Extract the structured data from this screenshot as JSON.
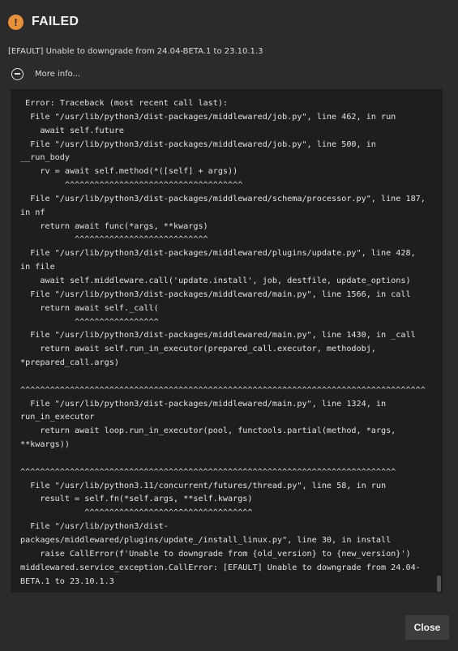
{
  "header": {
    "icon": "warning-icon",
    "icon_glyph": "!",
    "accent_color": "#e8913a",
    "title": "FAILED"
  },
  "message": "[EFAULT] Unable to downgrade from 24.04-BETA.1 to 23.10.1.3",
  "more_info": {
    "icon": "minus-circle-icon",
    "label": "More info..."
  },
  "traceback": [
    " Error: Traceback (most recent call last):",
    "  File \"/usr/lib/python3/dist-packages/middlewared/job.py\", line 462, in run",
    "    await self.future",
    "  File \"/usr/lib/python3/dist-packages/middlewared/job.py\", line 500, in",
    "__run_body",
    "    rv = await self.method(*([self] + args))",
    "         ^^^^^^^^^^^^^^^^^^^^^^^^^^^^^^^^^^^^",
    "  File \"/usr/lib/python3/dist-packages/middlewared/schema/processor.py\", line 187,",
    "in nf",
    "    return await func(*args, **kwargs)",
    "           ^^^^^^^^^^^^^^^^^^^^^^^^^^^",
    "  File \"/usr/lib/python3/dist-packages/middlewared/plugins/update.py\", line 428,",
    "in file",
    "    await self.middleware.call('update.install', job, destfile, update_options)",
    "  File \"/usr/lib/python3/dist-packages/middlewared/main.py\", line 1566, in call",
    "    return await self._call(",
    "           ^^^^^^^^^^^^^^^^^",
    "  File \"/usr/lib/python3/dist-packages/middlewared/main.py\", line 1430, in _call",
    "    return await self.run_in_executor(prepared_call.executor, methodobj,",
    "*prepared_call.args)",
    "",
    "^^^^^^^^^^^^^^^^^^^^^^^^^^^^^^^^^^^^^^^^^^^^^^^^^^^^^^^^^^^^^^^^^^^^^^^^^^^^^^^^^^",
    "  File \"/usr/lib/python3/dist-packages/middlewared/main.py\", line 1324, in",
    "run_in_executor",
    "    return await loop.run_in_executor(pool, functools.partial(method, *args,",
    "**kwargs))",
    "",
    "^^^^^^^^^^^^^^^^^^^^^^^^^^^^^^^^^^^^^^^^^^^^^^^^^^^^^^^^^^^^^^^^^^^^^^^^^^^^",
    "  File \"/usr/lib/python3.11/concurrent/futures/thread.py\", line 58, in run",
    "    result = self.fn(*self.args, **self.kwargs)",
    "             ^^^^^^^^^^^^^^^^^^^^^^^^^^^^^^^^^^",
    "  File \"/usr/lib/python3/dist-",
    "packages/middlewared/plugins/update_/install_linux.py\", line 30, in install",
    "    raise CallError(f'Unable to downgrade from {old_version} to {new_version}')",
    "middlewared.service_exception.CallError: [EFAULT] Unable to downgrade from 24.04-",
    "BETA.1 to 23.10.1.3"
  ],
  "actions": {
    "close_label": "Close"
  }
}
